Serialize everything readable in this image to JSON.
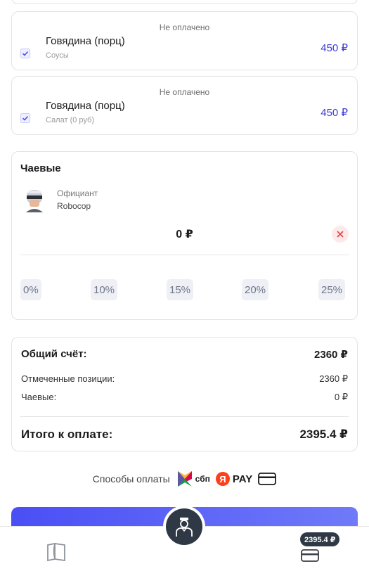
{
  "order_items": [
    {
      "status": "Не оплачено",
      "name": "Говядина (порц)",
      "sub": "Соусы",
      "price": "450 ₽"
    },
    {
      "status": "Не оплачено",
      "name": "Говядина (порц)",
      "sub": "Салат (0 руб)",
      "price": "450 ₽"
    }
  ],
  "tips": {
    "title": "Чаевые",
    "waiter_role": "Официант",
    "waiter_name": "Robocop",
    "amount": "0 ₽",
    "percents": [
      "0%",
      "10%",
      "15%",
      "20%",
      "25%"
    ]
  },
  "bill": {
    "total_label": "Общий счёт:",
    "total_value": "2360 ₽",
    "selected_label": "Отмеченные позиции:",
    "selected_value": "2360 ₽",
    "tips_label": "Чаевые:",
    "tips_value": "0 ₽",
    "final_label": "Итого к оплате:",
    "final_value": "2395.4 ₽"
  },
  "payment": {
    "label": "Способы оплаты",
    "sbp_label": "сбп",
    "yandex_letter": "Я",
    "yandex_label": "PAY"
  },
  "bottom_bar": {
    "cart_total": "2395.4 ₽"
  },
  "colors": {
    "accent": "#3e3bd8",
    "button_gradient_start": "#4a4ff5",
    "dark": "#2f3945",
    "danger": "#e04444"
  }
}
